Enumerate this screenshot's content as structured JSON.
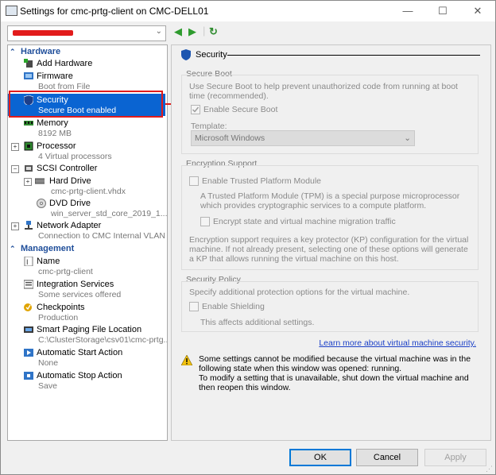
{
  "window": {
    "title": "Settings for cmc-prtg-client on CMC-DELL01",
    "minimize": "—",
    "maximize": "☐",
    "close": "✕"
  },
  "vm_combo": {
    "arrow": "⌄"
  },
  "nav": {
    "back": "◀",
    "forward": "▶",
    "refresh": "↻"
  },
  "tree": {
    "hardware_header": "Hardware",
    "management_header": "Management",
    "add_hardware": "Add Hardware",
    "firmware": {
      "label": "Firmware",
      "sub": "Boot from File"
    },
    "security": {
      "label": "Security",
      "sub": "Secure Boot enabled"
    },
    "memory": {
      "label": "Memory",
      "sub": "8192 MB"
    },
    "processor": {
      "label": "Processor",
      "sub": "4 Virtual processors"
    },
    "scsi": {
      "label": "SCSI Controller"
    },
    "hard_drive": {
      "label": "Hard Drive",
      "sub": "cmc-prtg-client.vhdx"
    },
    "dvd_drive": {
      "label": "DVD Drive",
      "sub": "win_server_std_core_2019_1..."
    },
    "network": {
      "label": "Network Adapter",
      "sub": "Connection to CMC Internal VLAN"
    },
    "name": {
      "label": "Name",
      "sub": "cmc-prtg-client"
    },
    "integration": {
      "label": "Integration Services",
      "sub": "Some services offered"
    },
    "checkpoints": {
      "label": "Checkpoints",
      "sub": "Production"
    },
    "smart_paging": {
      "label": "Smart Paging File Location",
      "sub": "C:\\ClusterStorage\\csv01\\cmc-prtg..."
    },
    "auto_start": {
      "label": "Automatic Start Action",
      "sub": "None"
    },
    "auto_stop": {
      "label": "Automatic Stop Action",
      "sub": "Save"
    }
  },
  "panel": {
    "title": "Security",
    "secure_boot": {
      "group_label": "Secure Boot",
      "desc": "Use Secure Boot to help prevent unauthorized code from running at boot time (recommended).",
      "enable_label": "Enable Secure Boot",
      "template_label": "Template:",
      "template_value": "Microsoft Windows",
      "template_arrow": "⌄"
    },
    "encryption": {
      "group_label": "Encryption Support",
      "tpm_label": "Enable Trusted Platform Module",
      "tpm_desc": "A Trusted Platform Module (TPM) is a special purpose microprocessor which provides cryptographic services to a compute platform.",
      "encrypt_label": "Encrypt state and virtual machine migration traffic",
      "kp_desc": "Encryption support requires a key protector (KP) configuration for the virtual machine. If not already present, selecting one of these options will generate a KP that allows running the virtual machine on this host."
    },
    "policy": {
      "group_label": "Security Policy",
      "desc": "Specify additional protection options for the virtual machine.",
      "shielding_label": "Enable Shielding",
      "shielding_desc": "This affects additional settings."
    },
    "learn_more": "Learn more about virtual machine security.",
    "warning_line1": "Some settings cannot be modified because the virtual machine was in the following state when this window was opened: running.",
    "warning_line2": "To modify a setting that is unavailable, shut down the virtual machine and then reopen this window."
  },
  "buttons": {
    "ok": "OK",
    "cancel": "Cancel",
    "apply": "Apply"
  },
  "colors": {
    "selection": "#0a64d2",
    "header_blue": "#1f4e9a",
    "highlight_red": "#e11c1c",
    "link": "#1a3fc7"
  }
}
